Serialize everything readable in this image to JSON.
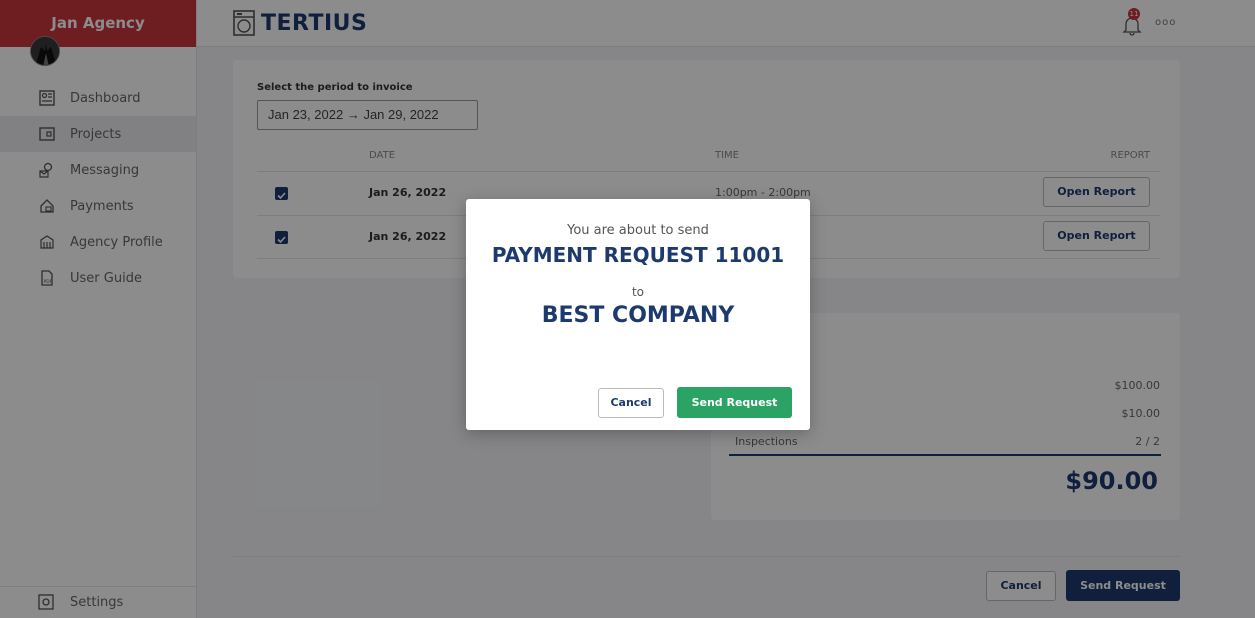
{
  "sidebar": {
    "agency_name": "Jan Agency",
    "items": [
      {
        "label": "Dashboard",
        "icon": "dashboard-icon"
      },
      {
        "label": "Projects",
        "icon": "projects-icon"
      },
      {
        "label": "Messaging",
        "icon": "messaging-icon"
      },
      {
        "label": "Payments",
        "icon": "payments-icon"
      },
      {
        "label": "Agency Profile",
        "icon": "agency-profile-icon"
      },
      {
        "label": "User Guide",
        "icon": "pdf-icon"
      }
    ],
    "settings_label": "Settings"
  },
  "topbar": {
    "brand": "TERTIUS",
    "notification_count": "11",
    "more": "ooo"
  },
  "period": {
    "label": "Select the period to invoice",
    "start": "Jan 23, 2022",
    "arrow": "→",
    "end": "Jan 29, 2022"
  },
  "table": {
    "headers": {
      "date": "DATE",
      "time": "TIME",
      "report": "REPORT"
    },
    "rows": [
      {
        "date": "Jan 26, 2022",
        "time": "1:00pm - 2:00pm",
        "report_label": "Open Report",
        "checked": true
      },
      {
        "date": "Jan 26, 2022",
        "time": "",
        "report_label": "Open Report",
        "checked": true
      }
    ]
  },
  "summary": {
    "line1": "$100.00",
    "line2": "$10.00",
    "inspections_label": "Inspections",
    "inspections_value": "2 / 2",
    "total": "$90.00"
  },
  "footer": {
    "cancel_label": "Cancel",
    "send_label": "Send Request"
  },
  "modal": {
    "intro": "You are about to send",
    "title": "PAYMENT REQUEST 11001",
    "to": "to",
    "company": "BEST COMPANY",
    "cancel_label": "Cancel",
    "send_label": "Send Request"
  },
  "colors": {
    "brand_red": "#c9353b",
    "navy": "#1d3a6e",
    "green": "#2aa364"
  }
}
